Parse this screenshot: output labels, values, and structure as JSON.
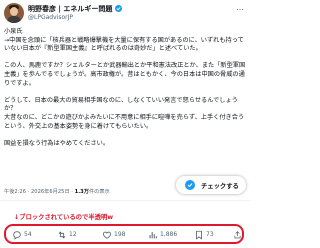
{
  "author": {
    "name": "明野春彦 | エネルギー問題",
    "verified_icon": "verified-badge-icon",
    "handle": "@LPGadvisorJP"
  },
  "tweet": {
    "paragraphs": [
      "小泉氏\n→中国を念頭に「核兵器と戦略爆撃機を大量に保有する国があるのに、いずれも持っていない日本が『新型軍国主義』と呼ばれるのは奇妙だ」と述べていた。",
      "この人、馬鹿ですか？シェルターとか武器輸出とか平和憲法改正とか、また「新型軍国主義」を歩んでるでしょうが。高市政権が。昔はともかく、今の日本は中国の脅威の通りですよ。",
      "どうして、日本の最大の貿易相手国なのに、しなくていい発言で怒らせるんでしょうか？\n大昔なのに、どこかの遊びかよみたいに不用意に相手に喧嘩を売らず、上手く付き合うという、外交上の基本姿勢を身に着けてもらいたい。",
      "国益を損なう行為はやめてください。"
    ]
  },
  "meta": {
    "time": "午後2:26 · 2026年6月25日 · ",
    "views": "1.3万",
    "views_suffix": "件の表示"
  },
  "fab": {
    "label": "チェックする"
  },
  "annotation": {
    "text": "↓ブロックされているので半透明w"
  },
  "actions": [
    {
      "name": "reply",
      "icon": "reply-icon",
      "count": "54"
    },
    {
      "name": "retweet",
      "icon": "retweet-icon",
      "count": "12"
    },
    {
      "name": "like",
      "icon": "like-icon",
      "count": "198"
    },
    {
      "name": "views",
      "icon": "analytics-icon",
      "count": "1,886"
    },
    {
      "name": "bookmark",
      "icon": "bookmark-icon",
      "count": "73"
    }
  ],
  "colors": {
    "accent": "#1d9bf0",
    "annotation_red": "#e0182c",
    "secondary_text": "#536471"
  }
}
